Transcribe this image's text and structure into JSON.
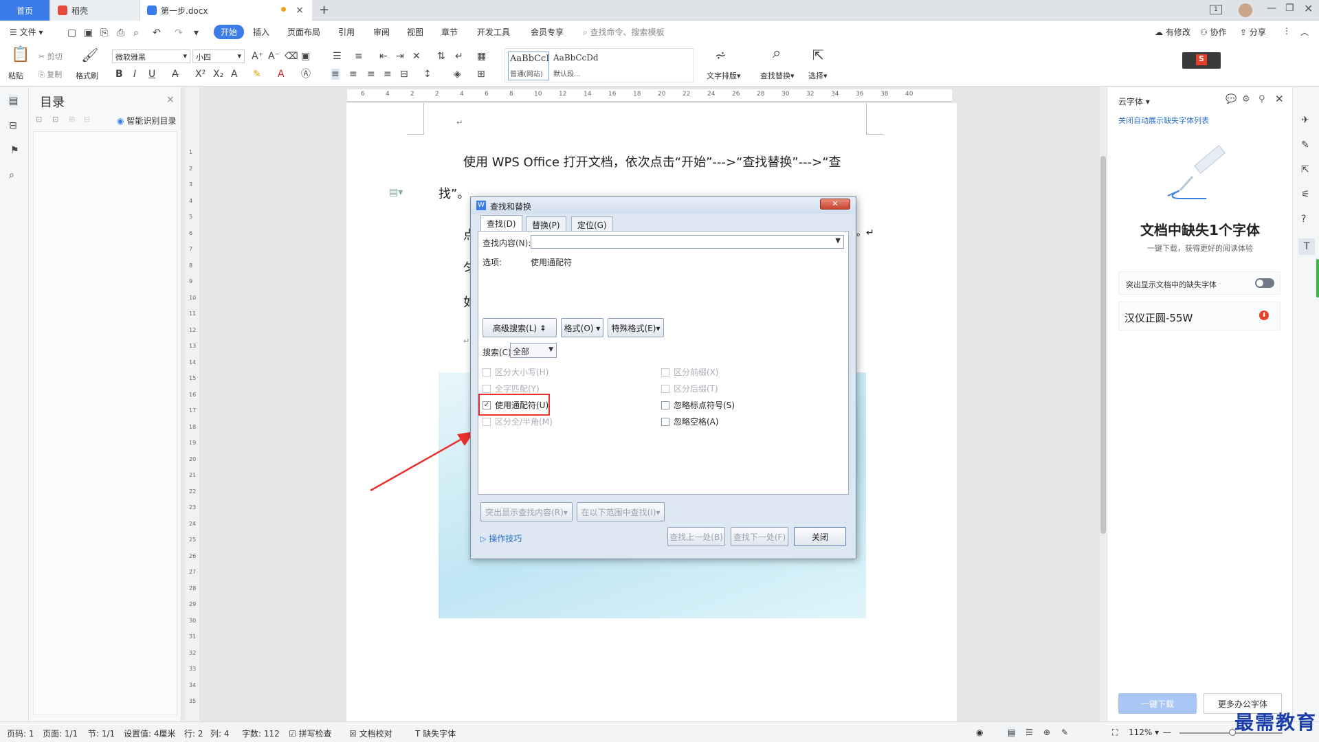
{
  "tabs": {
    "home": "首页",
    "daoke": "稻壳",
    "doc": "第一步.docx",
    "add": "+"
  },
  "menu": {
    "file": "文件",
    "start": "开始",
    "insert": "插入",
    "layout": "页面布局",
    "reference": "引用",
    "review": "审阅",
    "view": "视图",
    "chapter": "章节",
    "devtools": "开发工具",
    "vip": "会员专享",
    "search_placeholder": "查找命令、搜索模板",
    "modified": "有修改",
    "collab": "协作",
    "share": "分享"
  },
  "ribbon": {
    "paste": "粘贴",
    "cut": "剪切",
    "copy": "复制",
    "format_painter": "格式刷",
    "font": "微软雅黑",
    "size": "小四",
    "style1": "AaBbCcI",
    "style1_name": "普通(网站)",
    "style2": "AaBbCcDd",
    "style2_name": "默认段...",
    "text_layout": "文字排版",
    "find_replace": "查找替换",
    "select": "选择"
  },
  "toc": {
    "title": "目录",
    "smart": "智能识别目录"
  },
  "hruler_ticks": [
    "6",
    "4",
    "2",
    "2",
    "4",
    "6",
    "8",
    "10",
    "12",
    "14",
    "16",
    "18",
    "20",
    "22",
    "24",
    "26",
    "28",
    "30",
    "32",
    "34",
    "36",
    "38",
    "40"
  ],
  "vruler_ticks": [
    "1",
    "2",
    "3",
    "4",
    "5",
    "6",
    "7",
    "8",
    "9",
    "10",
    "11",
    "12",
    "13",
    "14",
    "15",
    "16",
    "17",
    "18",
    "19",
    "20",
    "21",
    "22",
    "23",
    "24",
    "25",
    "26",
    "27",
    "28",
    "29",
    "30",
    "31",
    "32",
    "33",
    "34",
    "35"
  ],
  "document": {
    "line1": "使用 WPS Office 打开文档，依次点击“开始”--->“查找替换”--->“查",
    "line2": "找”。",
    "frag1": "点",
    "frag2": "匀",
    "frag3": "如",
    "return1": "↵",
    "return2": "。↵"
  },
  "dialog": {
    "title": "查找和替换",
    "tab_find": "查找(D)",
    "tab_replace": "替换(P)",
    "tab_goto": "定位(G)",
    "find_label": "查找内容(N):",
    "find_value": "",
    "options_label": "选项:",
    "options_value": "使用通配符",
    "btn_advanced": "高级搜索(L) ⇞",
    "btn_format": "格式(O) ▾",
    "btn_special": "特殊格式(E)▾",
    "search_label": "搜索(C)",
    "search_value": "全部",
    "chk_case": "区分大小写(H)",
    "chk_whole": "全字匹配(Y)",
    "chk_wildcard": "使用通配符(U)",
    "chk_width": "区分全/半角(M)",
    "chk_prefix": "区分前缀(X)",
    "chk_suffix": "区分后缀(T)",
    "chk_punct": "忽略标点符号(S)",
    "chk_space": "忽略空格(A)",
    "btn_highlight": "突出显示查找内容(R)▾",
    "btn_range": "在以下范围中查找(I)▾",
    "tips": "操作技巧",
    "btn_prev": "查找上一处(B)",
    "btn_next": "查找下一处(F)",
    "btn_close": "关闭"
  },
  "rightpanel": {
    "header": "云字体",
    "close_auto": "关闭自动展示缺失字体列表",
    "title": "文档中缺失1个字体",
    "subtitle": "一键下载，获得更好的阅读体验",
    "toggle_label": "突出显示文档中的缺失字体",
    "font_name": "汉仪正圆-55W",
    "download": "一键下载",
    "more": "更多办公字体"
  },
  "status": {
    "page_no": "页码: 1",
    "pages": "页面: 1/1",
    "section": "节: 1/1",
    "setting": "设置值: 4厘米",
    "row": "行: 2",
    "col": "列: 4",
    "words": "字数: 112",
    "spell": "拼写检查",
    "proof": "文档校对",
    "missing_font": "缺失字体",
    "zoom": "112%"
  },
  "watermark": "最需教育",
  "colors": {
    "accent": "#3b7ce8",
    "annotation": "#e8312f"
  }
}
